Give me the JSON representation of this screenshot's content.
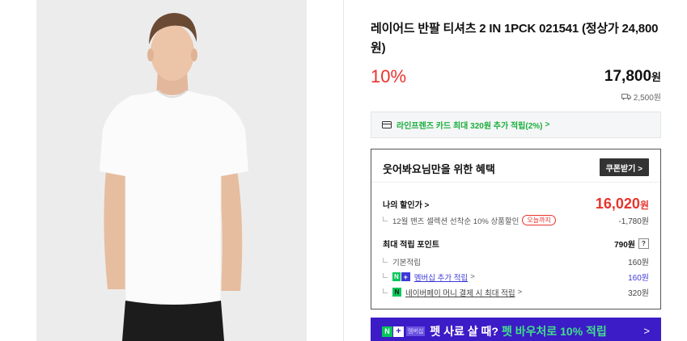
{
  "product": {
    "title": "레이어드 반팔 티셔츠 2 IN 1PCK 021541 (정상가 24,800원)",
    "discount": "10%",
    "price": "17,800",
    "price_unit": "원",
    "shipping_fee": "2,500원"
  },
  "card_banner": {
    "icon": "credit-card-icon",
    "text": "라인프렌즈 카드 최대 320원 추가 적립(2%)",
    "chevron": ">"
  },
  "benefit": {
    "title": "웃어봐요님만을 위한 혜택",
    "coupon_button": "쿠폰받기 >",
    "my_price_label": "나의 할인가 >",
    "my_price": "16,020",
    "my_price_unit": "원",
    "coupon_detail": "12월 맨즈 셀렉션 선착순 10% 상품할인",
    "deadline_badge": "오늘까지",
    "coupon_amount": "-1,780원",
    "points_label": "최대 적립 포인트",
    "points_total": "790원",
    "points_help": "?",
    "basic_label": "기본적립",
    "basic_value": "160원",
    "membership_label": "멤버십 추가 적립",
    "membership_value": "160원",
    "npay_label": "네이버페이 머니 결제 시 최대 적립",
    "npay_value": "320원"
  },
  "pet_banner": {
    "membership_tag": "멤버십",
    "text": "펫 사료 살 때?",
    "accent": "펫 바우처로 10% 적립",
    "arrow": ">"
  },
  "colors": {
    "accent_red": "#e8332d",
    "naver_green": "#03c75a",
    "pet_purple": "#3c1cc6",
    "link_blue": "#3d3ad7"
  }
}
